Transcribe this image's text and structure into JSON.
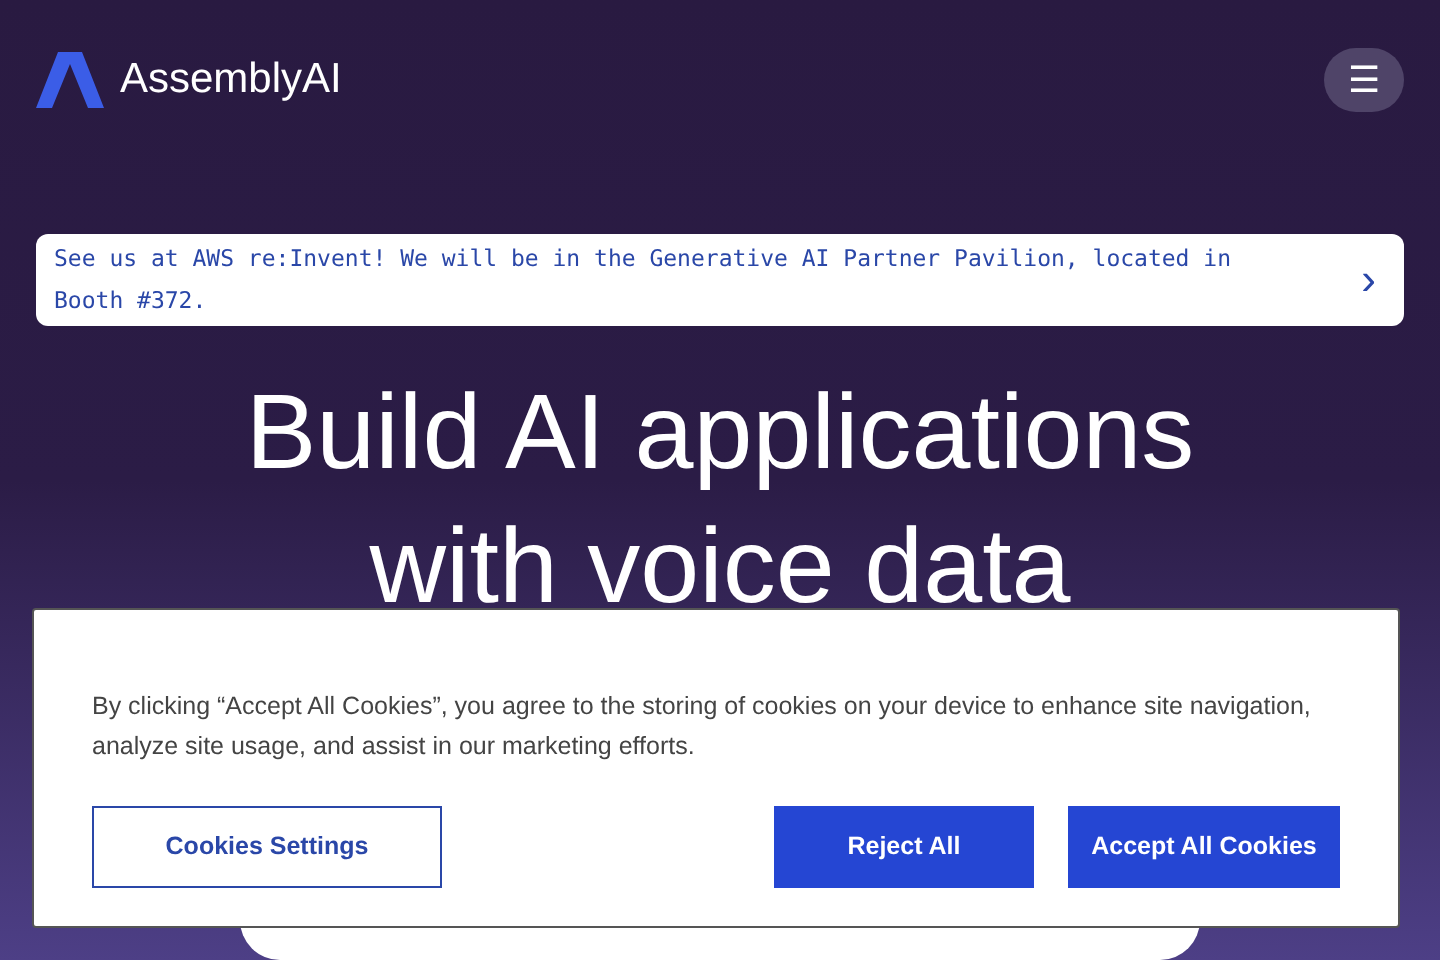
{
  "header": {
    "brand": "AssemblyAI",
    "menu_icon": "☰"
  },
  "announcement": {
    "text": "See us at AWS re:Invent! We will be in the Generative AI Partner Pavilion, located in Booth #372.",
    "arrow": "›"
  },
  "hero": {
    "title_lines": [
      "Build AI applications",
      "with voice data"
    ]
  },
  "cookie_banner": {
    "text": "By clicking “Accept All Cookies”, you agree to the storing of cookies on your device to enhance site navigation, analyze site usage, and assist in our marketing efforts.",
    "buttons": [
      {
        "label": "Cookies Settings",
        "kind": "outline"
      },
      {
        "label": "Reject All",
        "kind": "solid"
      },
      {
        "label": "Accept All Cookies",
        "kind": "solid"
      }
    ]
  }
}
